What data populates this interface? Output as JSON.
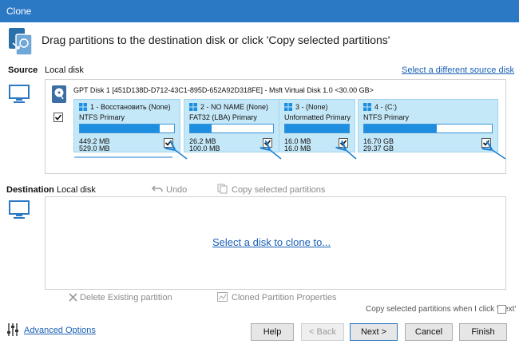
{
  "window": {
    "title": "Clone"
  },
  "banner": {
    "text": "Drag partitions to the destination disk or click 'Copy selected partitions'"
  },
  "source": {
    "label": "Source",
    "sublabel": "Local disk",
    "select_link": "Select a different source disk",
    "disk_header": "GPT Disk 1 [451D138D-D712-43C1-895D-652A92D318FE] - Msft     Virtual Disk     1.0  <30.00 GB>",
    "disk_checked": true,
    "partitions": [
      {
        "name": "1 - Восстановить (None)",
        "type": "NTFS Primary",
        "used": "449.2 MB",
        "size": "529.0 MB",
        "fill": 0.85,
        "checked": true
      },
      {
        "name": "2 - NO NAME (None)",
        "type": "FAT32 (LBA) Primary",
        "used": "26.2 MB",
        "size": "100.0 MB",
        "fill": 0.26,
        "checked": true
      },
      {
        "name": "3 - (None)",
        "type": "Unformatted Primary",
        "used": "16.0 MB",
        "size": "16.0 MB",
        "fill": 1.0,
        "checked": true
      },
      {
        "name": "4 - (C:)",
        "type": "NTFS Primary",
        "used": "16.70 GB",
        "size": "29.37 GB",
        "fill": 0.57,
        "checked": true
      }
    ]
  },
  "destination": {
    "label": "Destination",
    "sublabel": "Local disk",
    "undo": "Undo",
    "copy_selected": "Copy selected partitions",
    "select_disk_link": "Select a disk to clone to...",
    "delete_existing": "Delete Existing partition",
    "cloned_props": "Cloned Partition Properties",
    "copy_on_next": "Copy selected partitions when I click 'Next'"
  },
  "footer": {
    "advanced": "Advanced Options",
    "help": "Help",
    "back": "< Back",
    "next": "Next >",
    "cancel": "Cancel",
    "finish": "Finish"
  },
  "colors": {
    "titlebar": "#2b78c5",
    "link": "#1a5fb4",
    "partition_bg": "#c5e8f8",
    "bar_fill": "#1e8fe0",
    "annotation_arrow": "#1e7fd0"
  },
  "icons": [
    "clone-icon",
    "monitor-icon",
    "hdd-icon",
    "windows-icon",
    "undo-icon",
    "copy-icon",
    "delete-x-icon",
    "properties-icon",
    "sliders-icon",
    "checkmark-icon"
  ]
}
